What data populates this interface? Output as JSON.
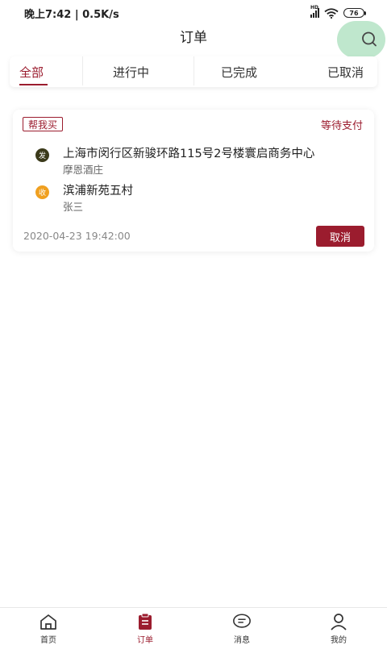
{
  "status_bar": {
    "time_speed": "晚上7:42 | 0.5K/s",
    "hd_label": "HD",
    "battery": "76"
  },
  "header": {
    "title": "订单"
  },
  "tabs": [
    {
      "label": "全部",
      "active": true
    },
    {
      "label": "进行中",
      "active": false
    },
    {
      "label": "已完成",
      "active": false
    },
    {
      "label": "已取消",
      "active": false
    }
  ],
  "orders": [
    {
      "type": "帮我买",
      "status": "等待支付",
      "from": {
        "badge": "发",
        "address": "上海市闵行区新骏环路115号2号楼寰启商务中心",
        "name": "摩恩酒庄"
      },
      "to": {
        "badge": "收",
        "address": "滨浦新苑五村",
        "name": "张三"
      },
      "time": "2020-04-23 19:42:00",
      "cancel_label": "取消"
    }
  ],
  "bottom_nav": [
    {
      "label": "首页",
      "icon": "home-icon",
      "active": false
    },
    {
      "label": "订单",
      "icon": "order-icon",
      "active": true
    },
    {
      "label": "消息",
      "icon": "message-icon",
      "active": false
    },
    {
      "label": "我的",
      "icon": "profile-icon",
      "active": false
    }
  ],
  "colors": {
    "accent": "#9b1c2e",
    "send_dot": "#3b3a1a",
    "receive_dot": "#f0a020",
    "search_bg": "#b9e5c8"
  }
}
